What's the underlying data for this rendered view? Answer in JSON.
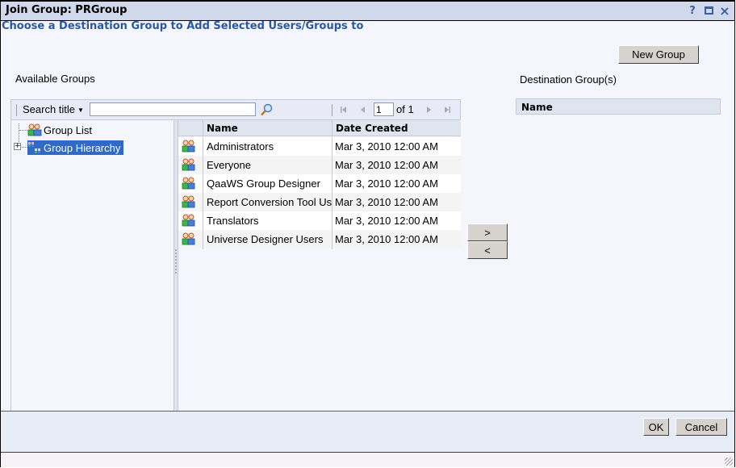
{
  "window": {
    "title": "Join Group: PRGroup",
    "controls": {
      "help": "?",
      "maximize": "maximize",
      "close": "×"
    }
  },
  "subtitle": "Choose a Destination Group to Add Selected Users/Groups to",
  "new_group_button": "New Group",
  "available": {
    "label": "Available Groups",
    "toolbar": {
      "search_dropdown": "Search title",
      "search_value": "",
      "page_value": "1",
      "page_of": "of 1",
      "pager_icons": [
        "first-page",
        "previous-page",
        "next-page",
        "last-page"
      ]
    },
    "tree": [
      {
        "label": "Group List",
        "icon": "group-list-icon",
        "selected": false
      },
      {
        "label": "Group Hierarchy",
        "icon": "group-hierarchy-icon",
        "selected": true,
        "expander": "+"
      }
    ],
    "grid": {
      "columns": [
        "",
        "Name",
        "Date Created"
      ],
      "rows": [
        {
          "name": "Administrators",
          "date": "Mar 3, 2010 12:00 AM"
        },
        {
          "name": "Everyone",
          "date": "Mar 3, 2010 12:00 AM"
        },
        {
          "name": "QaaWS Group Designer",
          "date": "Mar 3, 2010 12:00 AM"
        },
        {
          "name": "Report Conversion Tool Users",
          "date": "Mar 3, 2010 12:00 AM"
        },
        {
          "name": "Translators",
          "date": "Mar 3, 2010 12:00 AM"
        },
        {
          "name": "Universe Designer Users",
          "date": "Mar 3, 2010 12:00 AM"
        }
      ]
    }
  },
  "move_buttons": {
    "add": ">",
    "remove": "<"
  },
  "destination": {
    "label": "Destination Group(s)",
    "columns": [
      "Name"
    ],
    "rows": []
  },
  "footer": {
    "ok": "OK",
    "cancel": "Cancel"
  },
  "colors": {
    "titlebar": "#cfd9eb",
    "subtitle": "#2a57a4",
    "selection": "#316ac5",
    "button_face": "#d6d3ce",
    "panel_bg": "#f5f6fd"
  }
}
